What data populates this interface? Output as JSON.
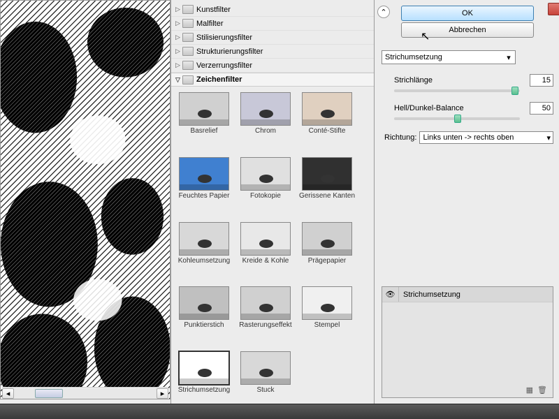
{
  "buttons": {
    "ok": "OK",
    "cancel": "Abbrechen"
  },
  "categories": [
    {
      "label": "Kunstfilter",
      "open": false
    },
    {
      "label": "Malfilter",
      "open": false
    },
    {
      "label": "Stilisierungsfilter",
      "open": false
    },
    {
      "label": "Strukturierungsfilter",
      "open": false
    },
    {
      "label": "Verzerrungsfilter",
      "open": false
    },
    {
      "label": "Zeichenfilter",
      "open": true
    }
  ],
  "filters": [
    "Basrelief",
    "Chrom",
    "Conté-Stifte",
    "Feuchtes Papier",
    "Fotokopie",
    "Gerissene Kanten",
    "Kohleumsetzung",
    "Kreide & Kohle",
    "Prägepapier",
    "Punktierstich",
    "Rasterungseffekt",
    "Stempel",
    "Strichumsetzung",
    "Stuck"
  ],
  "selected_filter": "Strichumsetzung",
  "params": {
    "current_filter_dd": "Strichumsetzung",
    "p1_label": "Strichlänge",
    "p1_value": "15",
    "p2_label": "Hell/Dunkel-Balance",
    "p2_value": "50",
    "p3_label": "Richtung:",
    "p3_value": "Links unten -> rechts oben"
  },
  "layer": {
    "name": "Strichumsetzung"
  }
}
